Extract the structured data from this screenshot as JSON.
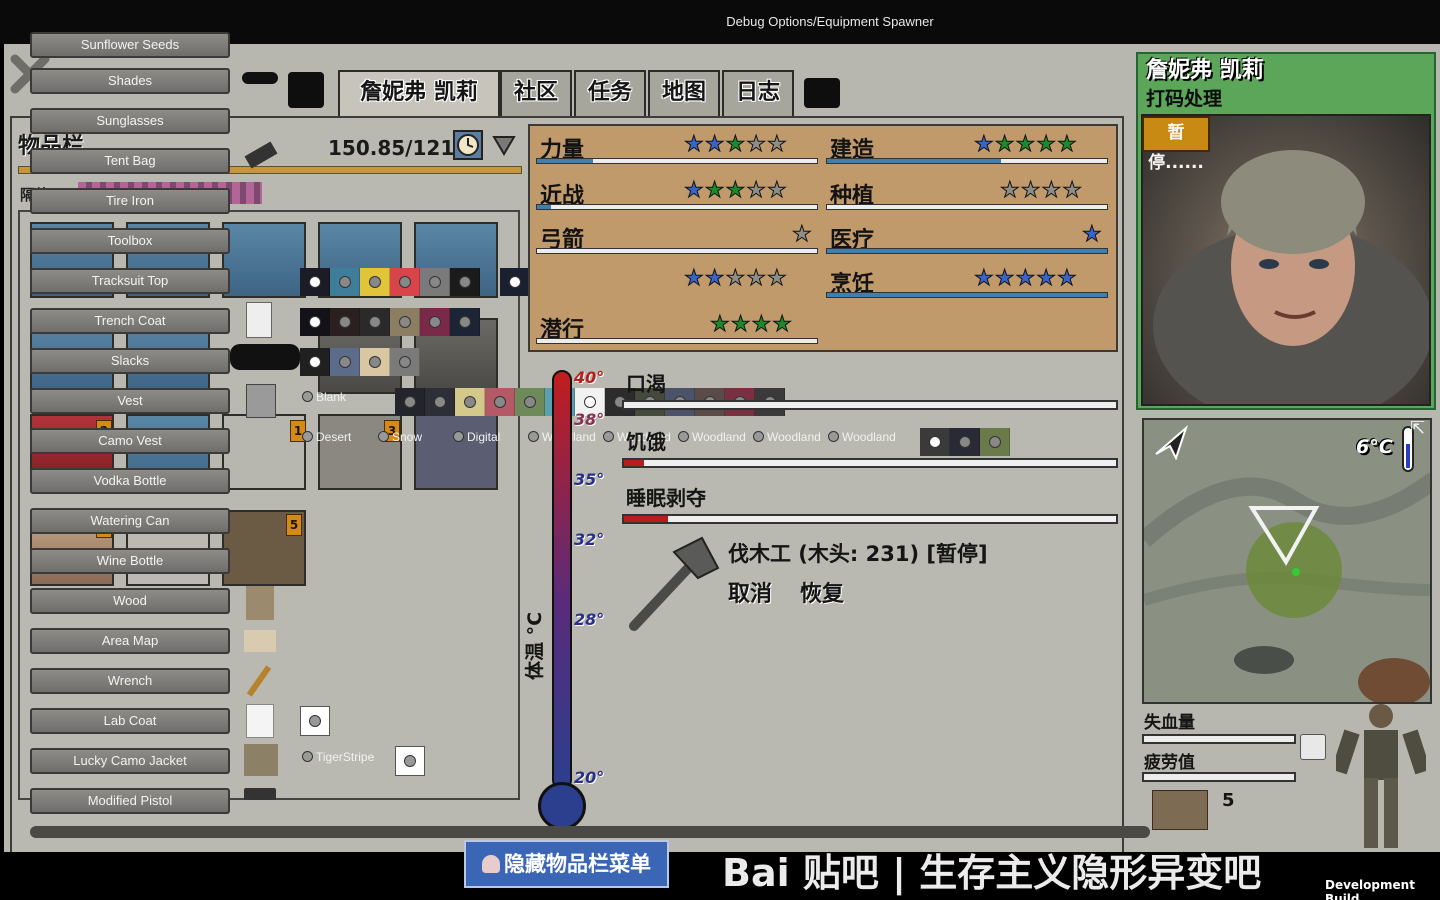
{
  "window_title": "Debug Options/Equipment Spawner",
  "tabs": [
    {
      "label": "詹妮弗 凯莉",
      "active": true
    },
    {
      "label": "社区"
    },
    {
      "label": "任务"
    },
    {
      "label": "地图"
    },
    {
      "label": "日志"
    }
  ],
  "inventory": {
    "title": "物品栏",
    "weight": "150.85/121 磅",
    "insulation_label": "隔热:"
  },
  "spawner_items": [
    "Sunflower Seeds",
    "Shades",
    "Sunglasses",
    "Tent Bag",
    "Tire Iron",
    "Toolbox",
    "Tracksuit Top",
    "Trench Coat",
    "Slacks",
    "Vest",
    "Camo Vest",
    "Vodka Bottle",
    "Watering Can",
    "Wine Bottle",
    "Wood",
    "Area Map",
    "Wrench",
    "Lab Coat",
    "Lucky Camo Jacket",
    "Modified Pistol"
  ],
  "slot_badges": [
    "1",
    "1",
    "2",
    "3",
    "1",
    "5"
  ],
  "pattern_options": [
    "Blank",
    "Desert",
    "Snow",
    "Digital",
    "Woodland",
    "Woodland",
    "Woodland",
    "Woodland",
    "Woodland",
    "TigerStripe"
  ],
  "stats": [
    {
      "label": "力量",
      "filled": 3,
      "blue": 2,
      "total": 5,
      "bar": 0.1
    },
    {
      "label": "近战",
      "filled": 2,
      "blue": 1,
      "total": 5,
      "bar": 0.05
    },
    {
      "label": "弓箭",
      "filled": 0,
      "blue": 0,
      "total": 1,
      "bar": 0
    },
    {
      "label": "潜行",
      "filled": 4,
      "blue": 0,
      "total": 4,
      "bar": 0
    },
    {
      "label": "建造",
      "filled": 4,
      "blue": 1,
      "total": 5,
      "bar": 0.6
    },
    {
      "label": "种植",
      "filled": 0,
      "blue": 0,
      "total": 4,
      "bar": 0
    },
    {
      "label": "医疗",
      "filled": 0,
      "blue": 1,
      "total": 1,
      "bar": 0
    },
    {
      "label": "烹饪",
      "filled": 0,
      "blue": 5,
      "total": 5,
      "bar": 1.0
    }
  ],
  "needs": [
    {
      "label": "口渴",
      "value": 0.0
    },
    {
      "label": "饥饿",
      "value": 0.04
    },
    {
      "label": "睡眠剥夺",
      "value": 0.09
    }
  ],
  "task": {
    "title": "伐木工 (木头: 231) [暂停]",
    "cancel": "取消",
    "resume": "恢复"
  },
  "thermometer": {
    "label": "体温 °C",
    "marks": [
      "40°",
      "38°",
      "35°",
      "32°",
      "28°",
      "20°"
    ]
  },
  "character": {
    "name": "詹妮弗 凯莉",
    "subtitle": "打码处理",
    "pause_badge": "暂停......"
  },
  "map": {
    "temperature": "6°C"
  },
  "status": {
    "blood_loss": "失血量",
    "fatigue": "疲劳值",
    "wood_count": "5"
  },
  "hide_menu_button": "隐藏物品栏菜单",
  "watermark": "Bai 贴吧 | 生存主义隐形异变吧",
  "dev_build": "Development Build"
}
